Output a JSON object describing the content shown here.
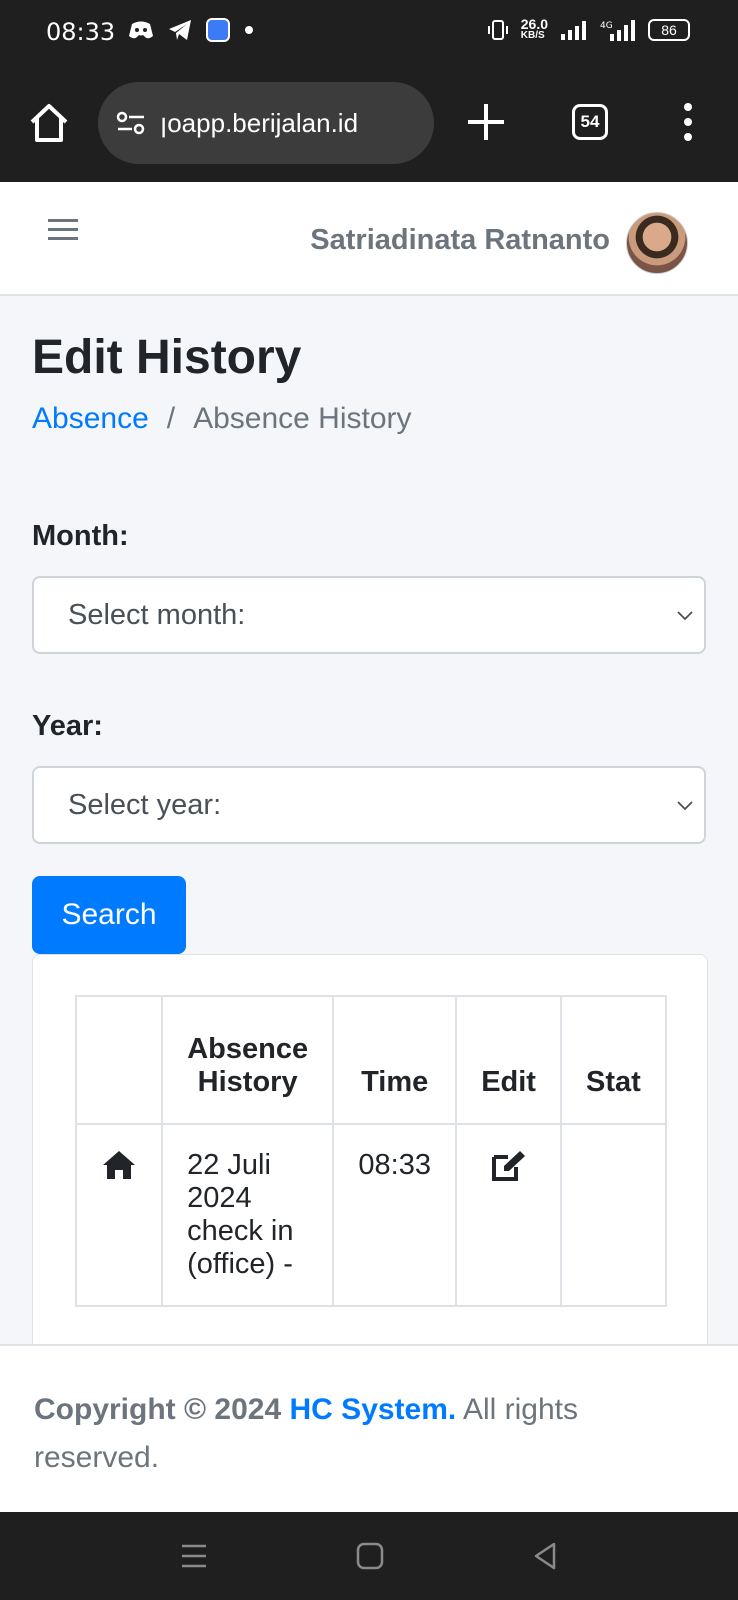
{
  "status_bar": {
    "time": "08:33",
    "net_speed": "26.0",
    "net_unit": "KB/S",
    "battery": "86"
  },
  "browser": {
    "url": "ꞁoapp.berijalan.id",
    "tab_count": "54",
    "icons": [
      "home-icon",
      "site-settings-icon",
      "plus-icon",
      "tabs-icon",
      "more-vert-icon"
    ]
  },
  "header": {
    "user_name": "Satriadinata Ratnanto"
  },
  "page": {
    "title": "Edit History",
    "breadcrumb": {
      "link": "Absence",
      "separator": "/",
      "current": "Absence History"
    }
  },
  "form": {
    "month_label": "Month:",
    "month_selected": "Select month:",
    "year_label": "Year:",
    "year_selected": "Select year:",
    "search_label": "Search"
  },
  "table": {
    "headers": [
      "",
      "Absence History",
      "Time",
      "Edit",
      "Stat"
    ],
    "rows": [
      {
        "icon": "home-icon",
        "history": "22 Juli 2024 check in (office) -",
        "time": "08:33",
        "edit_icon": "edit-icon",
        "status": ""
      }
    ]
  },
  "footer": {
    "copyright": "Copyright © 2024",
    "brand": "HC System.",
    "rights": "All rights reserved."
  },
  "colors": {
    "primary": "#007bff",
    "dark_bar": "#1f1f1f",
    "muted": "#6c757d"
  }
}
